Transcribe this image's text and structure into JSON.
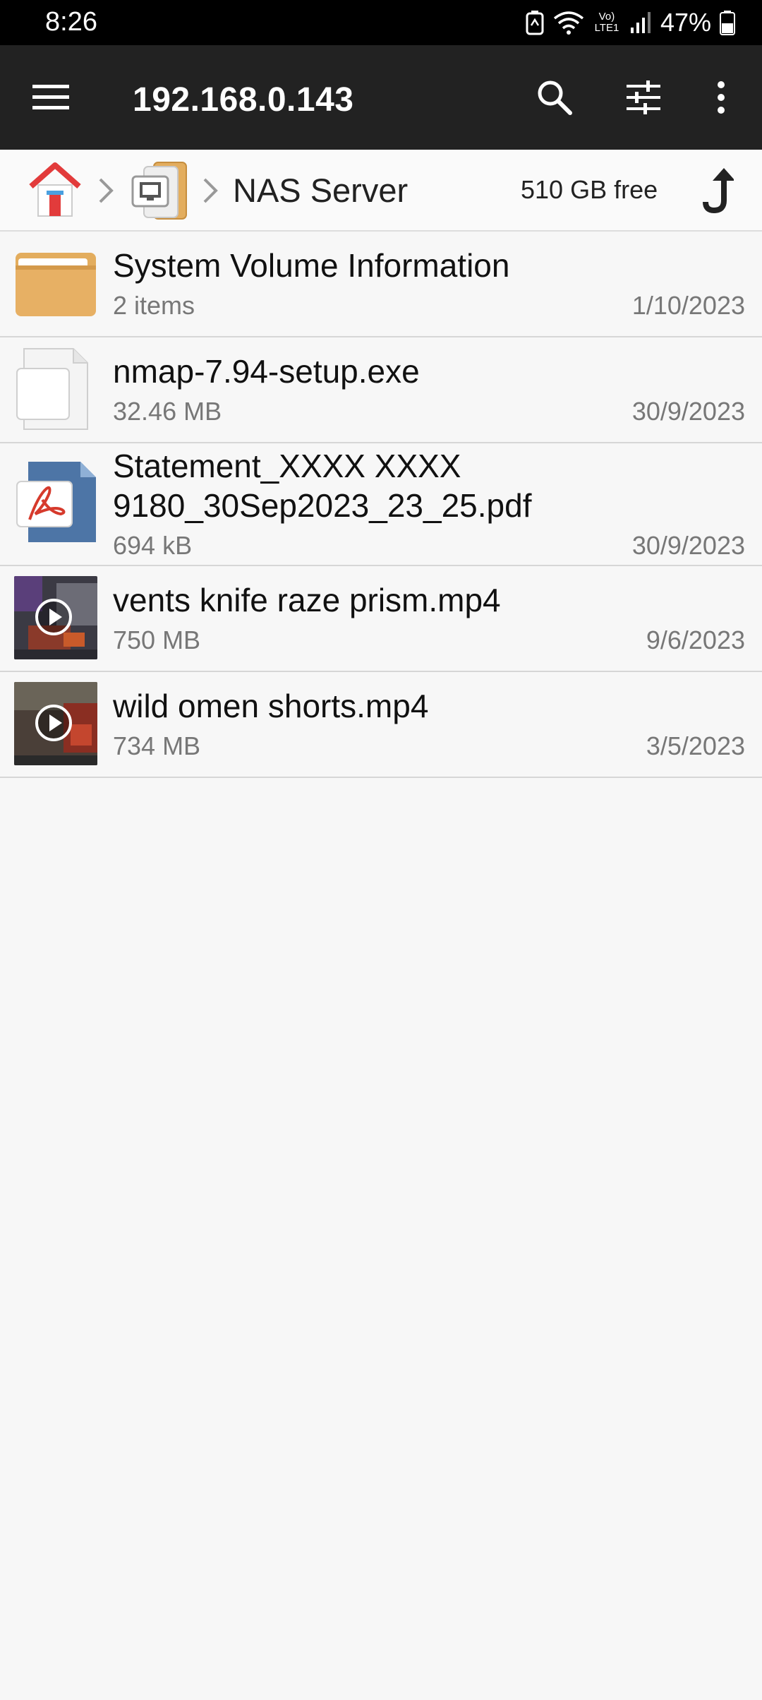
{
  "status": {
    "time": "8:26",
    "battery": "47%",
    "network": "Vo) LTE1"
  },
  "appbar": {
    "title": "192.168.0.143",
    "icons": [
      "menu-icon",
      "search-icon",
      "sliders-icon",
      "more-vert-icon"
    ]
  },
  "breadcrumb": {
    "current": "NAS Server",
    "free_space": "510 GB free"
  },
  "files": [
    {
      "name": "System Volume Information",
      "meta": "2 items",
      "date": "1/10/2023",
      "type": "folder"
    },
    {
      "name": "nmap-7.94-setup.exe",
      "meta": "32.46 MB",
      "date": "30/9/2023",
      "type": "file"
    },
    {
      "name_line1": "Statement_XXXX XXXX",
      "name_line2": "9180_30Sep2023_23_25.pdf",
      "meta": "694 kB",
      "date": "30/9/2023",
      "type": "pdf"
    },
    {
      "name": "vents knife raze prism.mp4",
      "meta": "750 MB",
      "date": "9/6/2023",
      "type": "video"
    },
    {
      "name": "wild omen shorts.mp4",
      "meta": "734 MB",
      "date": "3/5/2023",
      "type": "video"
    }
  ],
  "colors": {
    "appbar": "#222222",
    "folder": "#e3ad5e",
    "pdf_blue": "#4d75a6",
    "pdf_red": "#d63a2c"
  }
}
